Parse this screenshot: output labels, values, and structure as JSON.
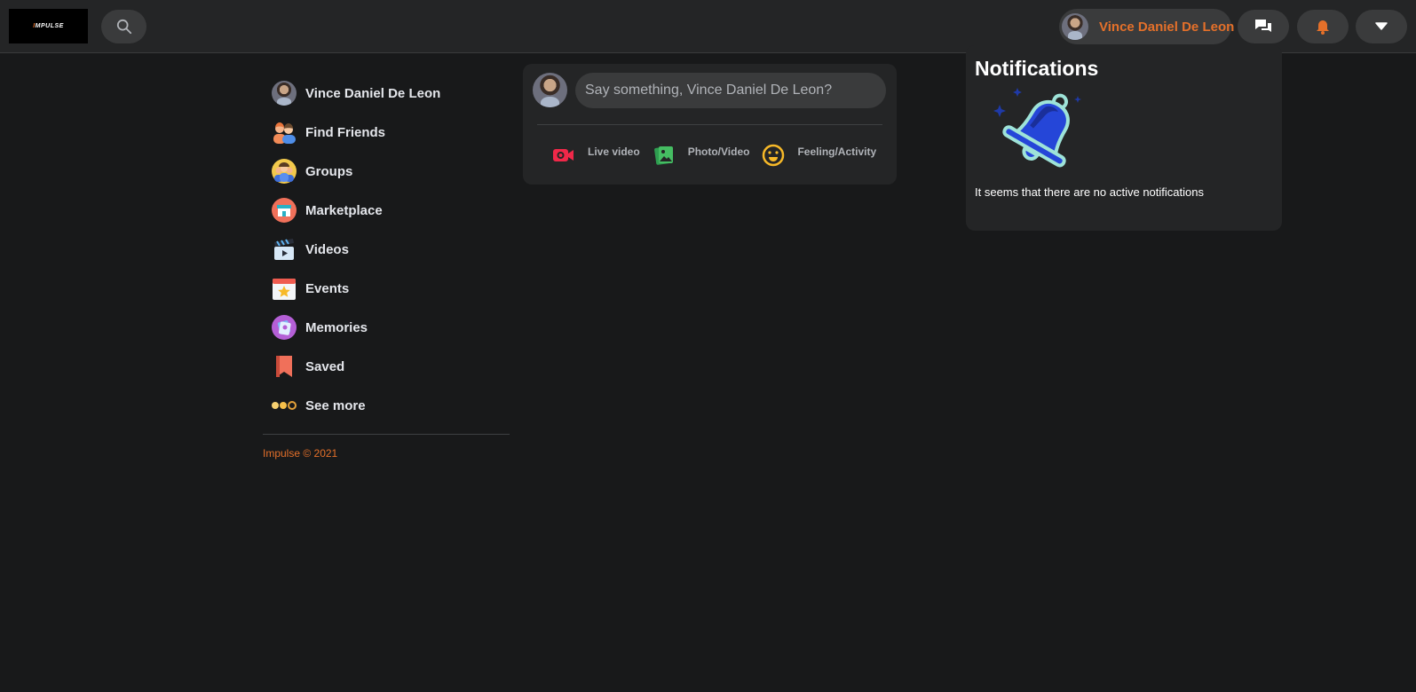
{
  "app": {
    "logo_text_accent": "I",
    "logo_text": "MPULSE"
  },
  "header": {
    "user_name": "Vince Daniel De Leon",
    "accent_color": "#e4702a"
  },
  "sidebar": {
    "items": [
      {
        "label": "Vince Daniel De Leon",
        "icon": "user-avatar"
      },
      {
        "label": "Find Friends",
        "icon": "friends-icon"
      },
      {
        "label": "Groups",
        "icon": "groups-icon"
      },
      {
        "label": "Marketplace",
        "icon": "marketplace-icon"
      },
      {
        "label": "Videos",
        "icon": "clapperboard-icon"
      },
      {
        "label": "Events",
        "icon": "calendar-icon"
      },
      {
        "label": "Memories",
        "icon": "memories-icon"
      },
      {
        "label": "Saved",
        "icon": "bookmark-icon"
      },
      {
        "label": "See more",
        "icon": "more-dots-icon"
      }
    ],
    "footer": "Impulse © 2021"
  },
  "composer": {
    "placeholder": "Say something, Vince Daniel De Leon?",
    "actions": [
      {
        "label": "Live video",
        "icon": "live-video-icon",
        "color": "#f02849"
      },
      {
        "label": "Photo/Video",
        "icon": "photo-icon",
        "color": "#45bd62"
      },
      {
        "label": "Feeling/Activity",
        "icon": "smiley-icon",
        "color": "#f7b928"
      }
    ]
  },
  "notifications": {
    "title": "Notifications",
    "empty_message": "It seems that there are no active notifications"
  }
}
